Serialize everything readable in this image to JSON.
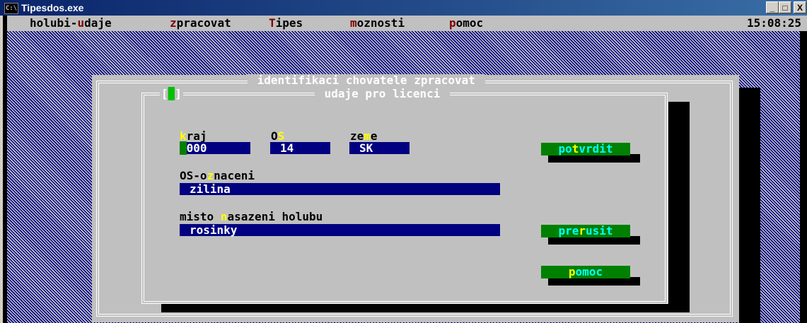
{
  "window": {
    "title": "Tipesdos.exe",
    "icon": "C:\\",
    "minimize": "_",
    "maximize": "□",
    "close": "X"
  },
  "menubar": {
    "items": [
      {
        "pre": "holubi-",
        "key": "u",
        "post": "daje"
      },
      {
        "pre": "",
        "key": "z",
        "post": "pracovat"
      },
      {
        "pre": "",
        "key": "T",
        "post": "ipes"
      },
      {
        "pre": "",
        "key": "m",
        "post": "oznosti"
      },
      {
        "pre": "",
        "key": "p",
        "post": "omoc"
      }
    ],
    "clock": "15:08:25"
  },
  "outer_dialog": {
    "title": " identifikaci chovatele zpracovat "
  },
  "inner_dialog": {
    "title": " udaje pro licenci ",
    "close_box": "[■]",
    "fields": {
      "kraj": {
        "label_key": "k",
        "label_rest": "raj",
        "value": "000"
      },
      "os": {
        "label_pre": "O",
        "label_key": "S",
        "value": "14"
      },
      "zeme": {
        "label_pre": "ze",
        "label_key": "m",
        "label_post": "e",
        "value": "SK"
      },
      "os_oznaceni": {
        "label_pre": "OS-o",
        "label_key": "z",
        "label_post": "naceni",
        "value": "zilina"
      },
      "misto": {
        "label_pre": "misto ",
        "label_key": "n",
        "label_post": "asazeni holubu",
        "value": "rosinky"
      }
    },
    "buttons": {
      "potvrdit": {
        "pre": "po",
        "key": "t",
        "post": "vrdit"
      },
      "prerusit": {
        "pre": "pre",
        "key": "r",
        "post": "usit"
      },
      "pomoc": {
        "pre": "",
        "key": "p",
        "post": "omoc"
      }
    }
  },
  "colors": {
    "titlebar": "#0a246a",
    "console_bg": "#c0c0c0",
    "field": "#000080",
    "button": "#008000",
    "hotkey": "#ffff00",
    "menu_hotkey": "#800000"
  }
}
